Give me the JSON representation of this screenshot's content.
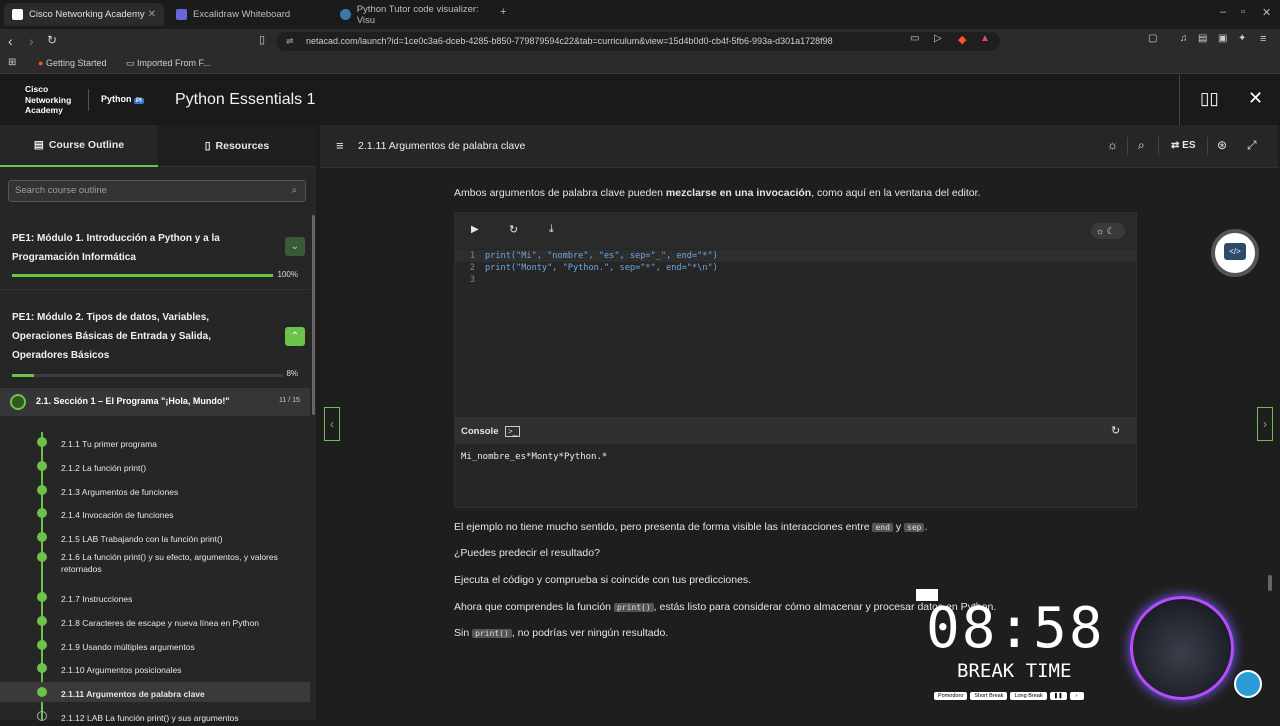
{
  "browser": {
    "tabs": [
      {
        "title": "Cisco Networking Academy",
        "active": true
      },
      {
        "title": "Excalidraw Whiteboard",
        "active": false
      },
      {
        "title": "Python Tutor code visualizer: Visu",
        "active": false
      }
    ],
    "url": "netacad.com/launch?id=1ce0c3a6-dceb-4285-b850-779879594c22&tab=curriculum&view=15d4b0d0-cb4f-5fb6-993a-d301a1728f98",
    "bookmarks": [
      "Getting Started",
      "Imported From F..."
    ]
  },
  "app": {
    "brand": [
      "Cisco",
      "Networking",
      "Academy"
    ],
    "python_badge": "Python",
    "title": "Python Essentials 1"
  },
  "sidebar": {
    "tabs": [
      "Course Outline",
      "Resources"
    ],
    "search_placeholder": "Search course outline",
    "modules": [
      {
        "title_lines": [
          "PE1: Módulo 1. Introducción a Python y a la",
          "Programación Informática"
        ],
        "progress": "100%",
        "progress_value": 1.0
      },
      {
        "title_lines": [
          "PE1: Módulo 2. Tipos de datos, Variables,",
          "Operaciones Básicas de Entrada y Salida,",
          "Operadores Básicos"
        ],
        "progress": "8%",
        "progress_value": 0.08
      }
    ],
    "section": {
      "title": "2.1. Sección 1 – El Programa \"¡Hola, Mundo!\"",
      "count": "11 / 15"
    },
    "lessons": [
      "2.1.1 Tu primer programa",
      "2.1.2 La función print()",
      "2.1.3 Argumentos de funciones",
      "2.1.4 Invocación de funciones",
      "2.1.5 LAB Trabajando con la función print()",
      "2.1.6 La función print() y su efecto, argumentos, y valores retornados",
      "2.1.7 Instrucciones",
      "2.1.8 Caracteres de escape y nueva línea en Python",
      "2.1.9 Usando múltiples argumentos",
      "2.1.10 Argumentos posicionales",
      "2.1.11 Argumentos de palabra clave",
      "2.1.12 LAB La función print() y sus argumentos"
    ],
    "active_lesson": "2.1.11 Argumentos de palabra clave"
  },
  "main": {
    "header_title": "2.1.11 Argumentos de palabra clave",
    "lang": "ES",
    "intro_a": "Ambos argumentos de palabra clave pueden ",
    "intro_b": "mezclarse en una invocación",
    "intro_c": ", como aquí en la ventana del editor.",
    "code_lines": [
      "print(\"Mi\", \"nombre\", \"es\", sep=\"_\", end=\"*\")",
      "print(\"Monty\", \"Python.\", sep=\"*\", end=\"*\\n\")",
      ""
    ],
    "console_label": "Console",
    "console_output": "Mi_nombre_es*Monty*Python.*",
    "p1_a": "El ejemplo no tiene mucho sentido, pero presenta de forma visible las interacciones entre ",
    "p1_code1": "end",
    "p1_b": " y ",
    "p1_code2": "sep",
    "p1_c": ".",
    "p2": "¿Puedes predecir el resultado?",
    "p3": "Ejecuta el código y comprueba si coincide con tus predicciones.",
    "p4_a": "Ahora que comprendes la función ",
    "p4_code": "print()",
    "p4_b": ", estás listo para considerar cómo almacenar y procesar datos en Python.",
    "p5_a": "Sin ",
    "p5_code": "print()",
    "p5_b": ", no podrías ver ningún resultado."
  },
  "overlay": {
    "timer": "08:58",
    "label": "BREAK TIME",
    "buttons": [
      "Pomodoro",
      "Short Break",
      "Long Break"
    ]
  },
  "colors": {
    "accent": "#6cc24a",
    "bg": "#1e1e1e",
    "sidebar": "#262626"
  }
}
